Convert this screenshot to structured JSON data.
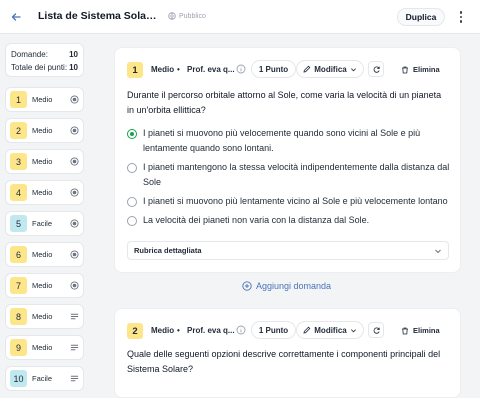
{
  "header": {
    "title": "Lista de Sistema Solare: Int...",
    "visibility": "Pubblico",
    "duplicate_label": "Duplica"
  },
  "summary": {
    "questions_label": "Domande:",
    "questions_value": "10",
    "points_label": "Totale dei punti:",
    "points_value": "10"
  },
  "sidebar": {
    "items": [
      {
        "num": "1",
        "label": "Medio",
        "icon": "radio-icon"
      },
      {
        "num": "2",
        "label": "Medio",
        "icon": "radio-icon"
      },
      {
        "num": "3",
        "label": "Medio",
        "icon": "radio-icon"
      },
      {
        "num": "4",
        "label": "Medio",
        "icon": "radio-icon"
      },
      {
        "num": "5",
        "label": "Facile",
        "icon": "radio-icon"
      },
      {
        "num": "6",
        "label": "Medio",
        "icon": "radio-icon"
      },
      {
        "num": "7",
        "label": "Medio",
        "icon": "radio-icon"
      },
      {
        "num": "8",
        "label": "Medio",
        "icon": "lines-icon"
      },
      {
        "num": "9",
        "label": "Medio",
        "icon": "lines-icon"
      },
      {
        "num": "10",
        "label": "Facile",
        "icon": "lines-icon"
      }
    ]
  },
  "questions": [
    {
      "num": "1",
      "difficulty": "Medio",
      "separator": "•",
      "author": "Prof. eva q...",
      "points": "1 Punto",
      "modify": "Modifica",
      "delete": "Elimina",
      "text": "Durante il percorso orbitale attorno al Sole, come varia la velocità di un pianeta in un'orbita ellittica?",
      "options": [
        {
          "text": "I pianeti si muovono più velocemente quando sono vicini al Sole e più lentamente quando sono lontani.",
          "selected": true
        },
        {
          "text": "I pianeti mantengono la stessa velocità indipendentemente dalla distanza dal Sole",
          "selected": false
        },
        {
          "text": "I pianeti si muovono più lentamente vicino al Sole e più velocemente lontano",
          "selected": false
        },
        {
          "text": "La velocità dei pianeti non varia con la distanza dal Sole.",
          "selected": false
        }
      ],
      "rubric": "Rubrica dettagliata"
    },
    {
      "num": "2",
      "difficulty": "Medio",
      "separator": "•",
      "author": "Prof. eva q...",
      "points": "1 Punto",
      "modify": "Modifica",
      "delete": "Elimina",
      "text": "Quale delle seguenti opzioni descrive correttamente i componenti principali del Sistema Solare?"
    }
  ],
  "add_question_label": "Aggiungi domanda",
  "colors": {
    "accent": "#4b74b8",
    "medium_badge": "#fde68a",
    "easy_badge": "#bfe9ef",
    "correct": "#16a34a"
  }
}
